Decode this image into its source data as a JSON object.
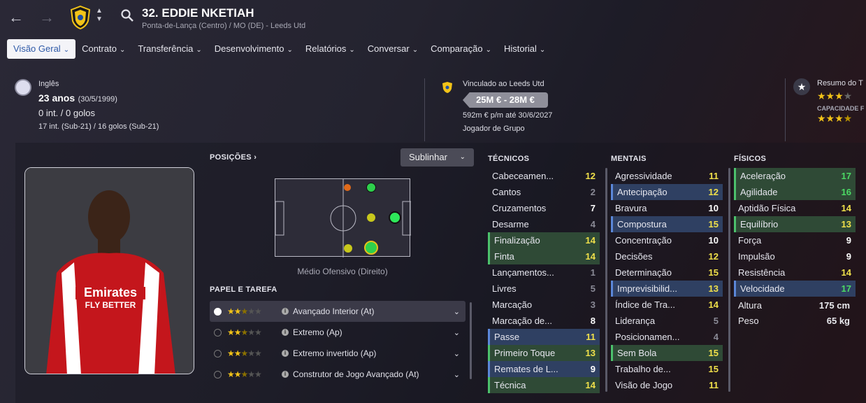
{
  "header": {
    "name": "32. EDDIE NKETIAH",
    "subtitle": "Ponta-de-Lança (Centro) / MO (DE) - Leeds Utd"
  },
  "tabs": [
    {
      "label": "Visão Geral"
    },
    {
      "label": "Contrato"
    },
    {
      "label": "Transferência"
    },
    {
      "label": "Desenvolvimento"
    },
    {
      "label": "Relatórios"
    },
    {
      "label": "Conversar"
    },
    {
      "label": "Comparação"
    },
    {
      "label": "Historial"
    }
  ],
  "info": {
    "nationality": "Inglês",
    "age": "23 anos",
    "dob": "(30/5/1999)",
    "caps": "0 int. / 0 golos",
    "u21": "17 int. (Sub-21) / 16 golos (Sub-21)"
  },
  "contract": {
    "club": "Vinculado ao Leeds Utd",
    "value": "25M € - 28M €",
    "wage": "592m € p/m até 30/6/2027",
    "status": "Jogador de Grupo"
  },
  "summary": {
    "title": "Resumo do T",
    "capacity": "CAPACIDADE F",
    "stars_current": 3,
    "stars_potential": 3.5
  },
  "positions": {
    "title": "POSIÇÕES",
    "filter": "Sublinhar",
    "role_caption": "Médio Ofensivo (Direito)"
  },
  "roles_title": "PAPEL E TAREFA",
  "roles": [
    {
      "stars": 2.5,
      "name": "Avançado Interior (At)"
    },
    {
      "stars": 2.5,
      "name": "Extremo (Ap)"
    },
    {
      "stars": 2.5,
      "name": "Extremo invertido (Ap)"
    },
    {
      "stars": 2.5,
      "name": "Construtor de Jogo Avançado (At)"
    }
  ],
  "technical": {
    "title": "TÉCNICOS",
    "items": [
      {
        "n": "Cabeceamen...",
        "v": "12"
      },
      {
        "n": "Cantos",
        "v": "2"
      },
      {
        "n": "Cruzamentos",
        "v": "7"
      },
      {
        "n": "Desarme",
        "v": "4"
      },
      {
        "n": "Finalização",
        "v": "14",
        "hl": "green"
      },
      {
        "n": "Finta",
        "v": "14",
        "hl": "green"
      },
      {
        "n": "Lançamentos...",
        "v": "1"
      },
      {
        "n": "Livres",
        "v": "5"
      },
      {
        "n": "Marcação",
        "v": "3"
      },
      {
        "n": "Marcação de...",
        "v": "8"
      },
      {
        "n": "Passe",
        "v": "11",
        "hl": "blue"
      },
      {
        "n": "Primeiro Toque",
        "v": "13",
        "hl": "green"
      },
      {
        "n": "Remates de L...",
        "v": "9",
        "hl": "blue"
      },
      {
        "n": "Técnica",
        "v": "14",
        "hl": "green"
      }
    ]
  },
  "mental": {
    "title": "MENTAIS",
    "items": [
      {
        "n": "Agressividade",
        "v": "11"
      },
      {
        "n": "Antecipação",
        "v": "12",
        "hl": "blue"
      },
      {
        "n": "Bravura",
        "v": "10"
      },
      {
        "n": "Compostura",
        "v": "15",
        "hl": "blue"
      },
      {
        "n": "Concentração",
        "v": "10"
      },
      {
        "n": "Decisões",
        "v": "12"
      },
      {
        "n": "Determinação",
        "v": "15"
      },
      {
        "n": "Imprevisibilid...",
        "v": "13",
        "hl": "blue"
      },
      {
        "n": "Índice de Tra...",
        "v": "14"
      },
      {
        "n": "Liderança",
        "v": "5"
      },
      {
        "n": "Posicionamen...",
        "v": "4"
      },
      {
        "n": "Sem Bola",
        "v": "15",
        "hl": "green"
      },
      {
        "n": "Trabalho de...",
        "v": "15"
      },
      {
        "n": "Visão de Jogo",
        "v": "11"
      }
    ]
  },
  "physical": {
    "title": "FÍSICOS",
    "items": [
      {
        "n": "Aceleração",
        "v": "17",
        "hl": "green"
      },
      {
        "n": "Agilidade",
        "v": "16",
        "hl": "green"
      },
      {
        "n": "Aptidão Física",
        "v": "14"
      },
      {
        "n": "Equilíbrio",
        "v": "13",
        "hl": "green"
      },
      {
        "n": "Força",
        "v": "9"
      },
      {
        "n": "Impulsão",
        "v": "9"
      },
      {
        "n": "Resistência",
        "v": "14"
      },
      {
        "n": "Velocidade",
        "v": "17",
        "hl": "blue"
      }
    ]
  },
  "body": {
    "height_label": "Altura",
    "height": "175 cm",
    "weight_label": "Peso",
    "weight": "65 kg"
  },
  "colors": {
    "excellent": "#4cd964",
    "good": "#f0e04a",
    "avg": "#ffffff",
    "weak": "#8a8a96"
  }
}
